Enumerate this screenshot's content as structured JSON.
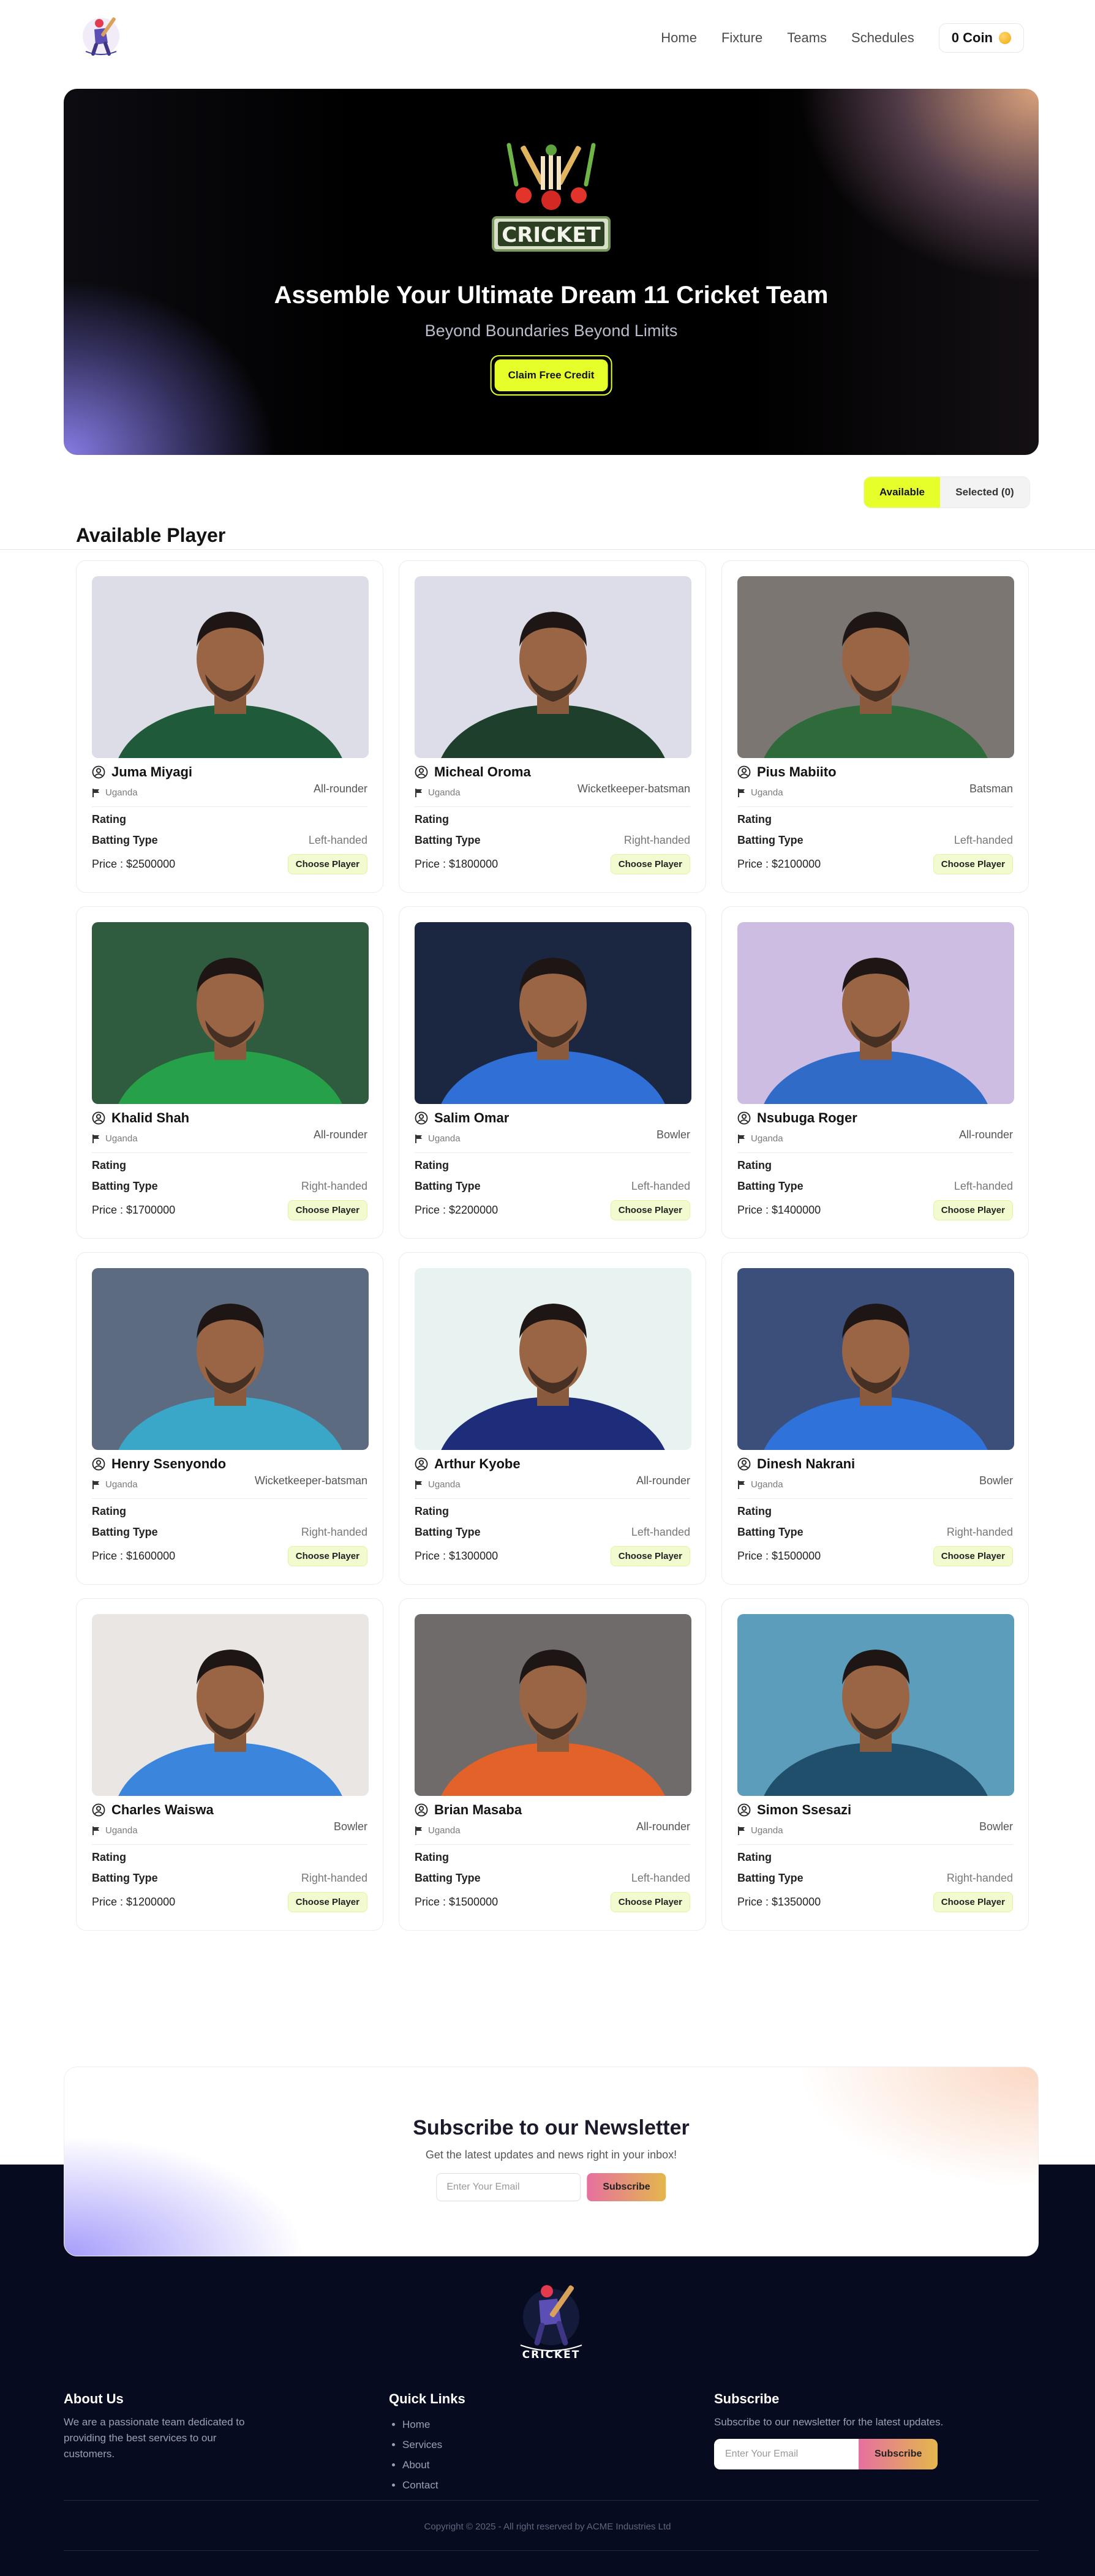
{
  "nav": {
    "links": [
      "Home",
      "Fixture",
      "Teams",
      "Schedules"
    ],
    "coin": "0 Coin"
  },
  "hero": {
    "logo_text": "CRICKET",
    "title": "Assemble Your Ultimate Dream 11 Cricket Team",
    "subtitle": "Beyond Boundaries Beyond Limits",
    "button": "Claim Free Credit"
  },
  "toggle": {
    "available": "Available",
    "selected": "Selected (0)"
  },
  "section_title": "Available Player",
  "labels": {
    "rating": "Rating",
    "batting_type": "Batting Type",
    "price_prefix": "Price : ",
    "choose": "Choose Player"
  },
  "players": [
    {
      "name": "Juma Miyagi",
      "country": "Uganda",
      "role": "All-rounder",
      "batting": "Left-handed",
      "price": "$2500000",
      "jersey": "#1f5a3a",
      "bg": "#dcdde6"
    },
    {
      "name": "Micheal Oroma",
      "country": "Uganda",
      "role": "Wicketkeeper-batsman",
      "batting": "Right-handed",
      "price": "$1800000",
      "jersey": "#1d3f2c",
      "bg": "#dcdde8"
    },
    {
      "name": "Pius Mabiito",
      "country": "Uganda",
      "role": "Batsman",
      "batting": "Left-handed",
      "price": "$2100000",
      "jersey": "#2e6a3a",
      "bg": "#7b7672"
    },
    {
      "name": "Khalid Shah",
      "country": "Uganda",
      "role": "All-rounder",
      "batting": "Right-handed",
      "price": "$1700000",
      "jersey": "#27a04a",
      "bg": "#2f5c3e"
    },
    {
      "name": "Salim Omar",
      "country": "Uganda",
      "role": "Bowler",
      "batting": "Left-handed",
      "price": "$2200000",
      "jersey": "#2f6fd6",
      "bg": "#1b2740"
    },
    {
      "name": "Nsubuga Roger",
      "country": "Uganda",
      "role": "All-rounder",
      "batting": "Left-handed",
      "price": "$1400000",
      "jersey": "#2f6bc7",
      "bg": "#cdbde3"
    },
    {
      "name": "Henry Ssenyondo",
      "country": "Uganda",
      "role": "Wicketkeeper-batsman",
      "batting": "Right-handed",
      "price": "$1600000",
      "jersey": "#3aa7c8",
      "bg": "#5d6b80"
    },
    {
      "name": "Arthur Kyobe",
      "country": "Uganda",
      "role": "All-rounder",
      "batting": "Left-handed",
      "price": "$1300000",
      "jersey": "#1e2d7a",
      "bg": "#e8f3f1"
    },
    {
      "name": "Dinesh Nakrani",
      "country": "Uganda",
      "role": "Bowler",
      "batting": "Right-handed",
      "price": "$1500000",
      "jersey": "#2f72d9",
      "bg": "#3b4f7a"
    },
    {
      "name": "Charles Waiswa",
      "country": "Uganda",
      "role": "Bowler",
      "batting": "Right-handed",
      "price": "$1200000",
      "jersey": "#3b86dc",
      "bg": "#e9e6e4"
    },
    {
      "name": "Brian Masaba",
      "country": "Uganda",
      "role": "All-rounder",
      "batting": "Left-handed",
      "price": "$1500000",
      "jersey": "#e2622a",
      "bg": "#6f6b6a"
    },
    {
      "name": "Simon Ssesazi",
      "country": "Uganda",
      "role": "Bowler",
      "batting": "Right-handed",
      "price": "$1350000",
      "jersey": "#1f4f6a",
      "bg": "#5b9dbb"
    }
  ],
  "newsletter": {
    "title": "Subscribe to our Newsletter",
    "subtitle": "Get the latest updates and news right in your inbox!",
    "placeholder": "Enter Your Email",
    "button": "Subscribe"
  },
  "footer": {
    "logo_text": "CRICKET",
    "about_title": "About Us",
    "about_text": "We are a passionate team dedicated to providing the best services to our customers.",
    "links_title": "Quick Links",
    "links": [
      "Home",
      "Services",
      "About",
      "Contact"
    ],
    "subscribe_title": "Subscribe",
    "subscribe_text": "Subscribe to our newsletter for the latest updates.",
    "placeholder": "Enter Your Email",
    "button": "Subscribe",
    "copyright": "Copyright © 2025 - All right reserved by ACME Industries Ltd"
  }
}
